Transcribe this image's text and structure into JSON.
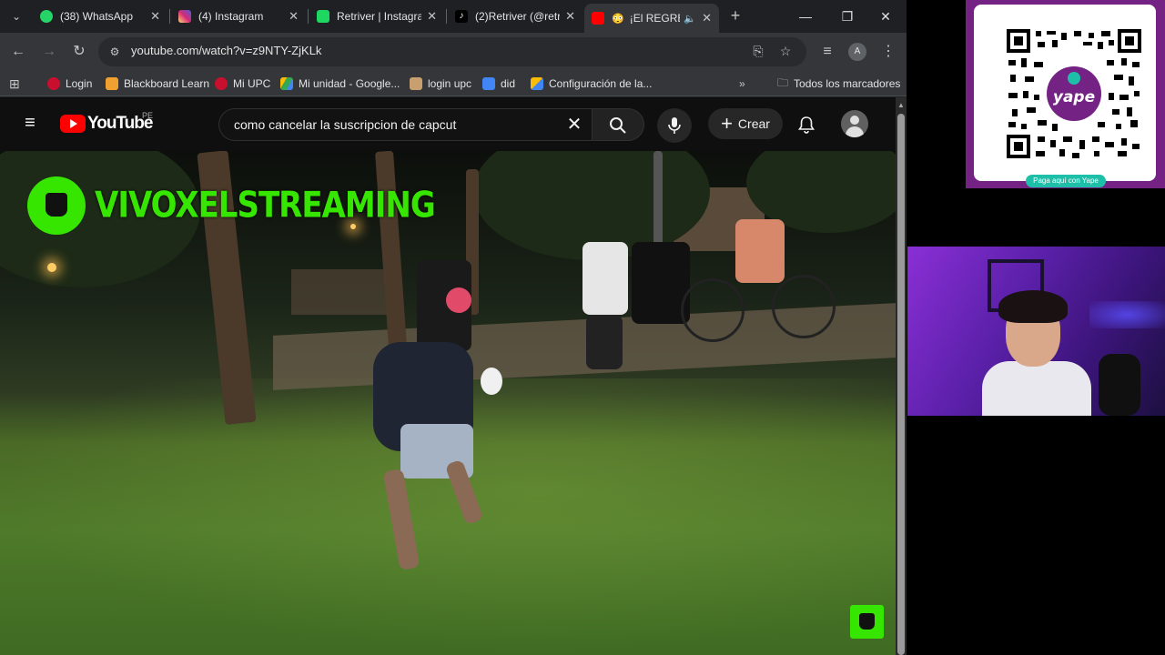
{
  "browser": {
    "tabs": [
      {
        "label": "(38) WhatsApp",
        "favicon_color": "#25d366",
        "badge": "38"
      },
      {
        "label": "(4) Instagram",
        "favicon_color": "#e1306c"
      },
      {
        "label": "Retriver | Instagra",
        "favicon_color": "#1ed760"
      },
      {
        "label": "(2)Retriver (@retr",
        "favicon_color": "#000000"
      },
      {
        "label": "¡El REGRE",
        "favicon_color": "#ff0000",
        "active": true
      }
    ],
    "new_tab_icon": "plus-icon",
    "url": "youtube.com/watch?v=z9NTY-ZjKLk",
    "profile_initial": "A",
    "bookmarks": [
      {
        "label": "Login",
        "icon_color": "#c8102e"
      },
      {
        "label": "Blackboard Learn",
        "icon_color": "#f0a030"
      },
      {
        "label": "Mi UPC",
        "icon_color": "#c8102e"
      },
      {
        "label": "Mi unidad - Google...",
        "icon_color": "#34a853"
      },
      {
        "label": "login upc",
        "icon_color": "#c8a070"
      },
      {
        "label": "did",
        "icon_color": "#4285f4"
      },
      {
        "label": "Configuración de la...",
        "icon_color": "#4285f4"
      }
    ],
    "all_bookmarks_label": "Todos los marcadores"
  },
  "youtube": {
    "logo_text": "YouTube",
    "country": "PE",
    "search_query": "como cancelar la suscripcion de capcut",
    "create_label": "Crear"
  },
  "video": {
    "watermark_text": "VIVOXELSTREAMING",
    "brand_color": "#37e600"
  },
  "overlay": {
    "qr_brand": "yape",
    "qr_caption": "Paga aquí con Yape",
    "panel_color": "#742284"
  }
}
